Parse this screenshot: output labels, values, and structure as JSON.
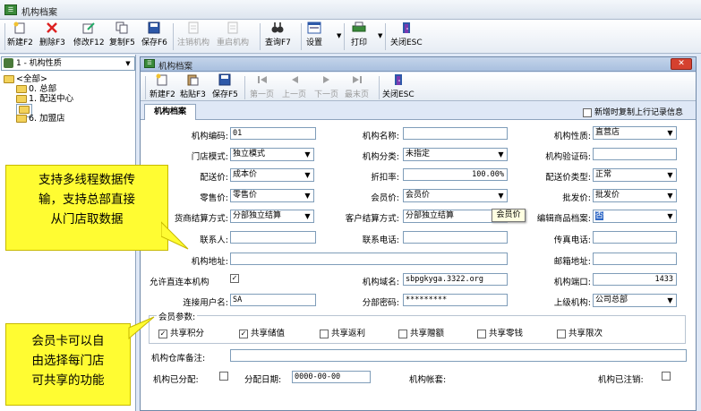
{
  "app": {
    "title": "机构档案"
  },
  "main_toolbar": [
    {
      "id": "new",
      "label": "新建F2",
      "icon": "new-doc-icon",
      "enabled": true
    },
    {
      "id": "delete",
      "label": "删除F3",
      "icon": "delete-x-icon",
      "enabled": true
    },
    {
      "id": "modify",
      "label": "修改F12",
      "icon": "edit-icon",
      "enabled": true
    },
    {
      "id": "copy",
      "label": "复制F5",
      "icon": "copy-icon",
      "enabled": true
    },
    {
      "id": "save",
      "label": "保存F6",
      "icon": "save-disk-icon",
      "enabled": true
    },
    {
      "id": "cancel-org",
      "label": "注销机构",
      "icon": "cancel-doc-icon",
      "enabled": false
    },
    {
      "id": "restart-org",
      "label": "重启机构",
      "icon": "restart-doc-icon",
      "enabled": false
    },
    {
      "id": "query",
      "label": "查询F7",
      "icon": "binoculars-icon",
      "enabled": true
    },
    {
      "id": "settings",
      "label": "设置",
      "icon": "settings-window-icon",
      "enabled": true
    },
    {
      "id": "print",
      "label": "打印",
      "icon": "printer-icon",
      "enabled": true
    },
    {
      "id": "close",
      "label": "关闭ESC",
      "icon": "exit-door-icon",
      "enabled": true
    }
  ],
  "sidebar": {
    "combo_value": "1 - 机构性质",
    "tree": [
      {
        "label": "<全部>",
        "level": 0
      },
      {
        "label": "0. 总部",
        "level": 1
      },
      {
        "label": "1. 配送中心",
        "level": 1
      },
      {
        "label": "5. 直营店",
        "level": 1,
        "selected": true
      },
      {
        "label": "6. 加盟店",
        "level": 1
      }
    ]
  },
  "inner_window": {
    "title": "机构档案",
    "toolbar": [
      {
        "id": "new",
        "label": "新建F2",
        "icon": "new-doc-icon",
        "enabled": true
      },
      {
        "id": "paste",
        "label": "粘贴F3",
        "icon": "paste-icon",
        "enabled": true
      },
      {
        "id": "save",
        "label": "保存F5",
        "icon": "save-disk-icon",
        "enabled": true
      },
      {
        "id": "first",
        "label": "第一页",
        "icon": "first-page-icon",
        "enabled": false
      },
      {
        "id": "prev",
        "label": "上一页",
        "icon": "prev-page-icon",
        "enabled": false
      },
      {
        "id": "next",
        "label": "下一页",
        "icon": "next-page-icon",
        "enabled": false
      },
      {
        "id": "last",
        "label": "最末页",
        "icon": "last-page-icon",
        "enabled": false
      },
      {
        "id": "close",
        "label": "关闭ESC",
        "icon": "exit-door-icon",
        "enabled": true
      }
    ],
    "tab_label": "机构档案",
    "copy_prev_label": "新增时复制上行记录信息"
  },
  "form": {
    "org_code": {
      "label": "机构编码:",
      "value": "01"
    },
    "org_name": {
      "label": "机构名称:",
      "value": ""
    },
    "org_nature": {
      "label": "机构性质:",
      "value": "直营店"
    },
    "store_mode": {
      "label": "门店模式:",
      "value": "独立模式"
    },
    "org_category": {
      "label": "机构分类:",
      "value": "未指定"
    },
    "org_verify_code": {
      "label": "机构验证码:",
      "value": ""
    },
    "delivery_price": {
      "label": "配送价:",
      "value": "成本价"
    },
    "discount_rate": {
      "label": "折扣率:",
      "value": "100.00%"
    },
    "delivery_price_type": {
      "label": "配送价类型:",
      "value": "正常"
    },
    "retail_price": {
      "label": "零售价:",
      "value": "零售价"
    },
    "member_price": {
      "label": "会员价:",
      "value": "会员价"
    },
    "wholesale_price": {
      "label": "批发价:",
      "value": "批发价"
    },
    "supplier_settlement": {
      "label": "货商结算方式:",
      "value": "分部独立结算"
    },
    "customer_settlement": {
      "label": "客户结算方式:",
      "value": "分部独立结算"
    },
    "edit_goods_archive": {
      "label": "编辑商品档案:",
      "value": "否"
    },
    "contact": {
      "label": "联系人:",
      "value": ""
    },
    "contact_phone": {
      "label": "联系电话:",
      "value": ""
    },
    "fax": {
      "label": "传真电话:",
      "value": ""
    },
    "org_address": {
      "label": "机构地址:",
      "value": ""
    },
    "postal_address": {
      "label": "邮箱地址:",
      "value": ""
    },
    "allow_direct": {
      "label": "允许直连本机构",
      "checked": "✓"
    },
    "org_domain": {
      "label": "机构域名:",
      "value": "sbpgkyga.3322.org"
    },
    "org_port": {
      "label": "机构端口:",
      "value": "1433"
    },
    "conn_user": {
      "label": "连接用户名:",
      "value": "SA"
    },
    "branch_password": {
      "label": "分部密码:",
      "value": "*********"
    },
    "parent_org": {
      "label": "上级机构:",
      "value": "公司总部"
    },
    "member_params": {
      "title": "会员参数:",
      "items": [
        {
          "label": "共享积分",
          "checked": "✓"
        },
        {
          "label": "共享储值",
          "checked": "✓"
        },
        {
          "label": "共享返利",
          "checked": ""
        },
        {
          "label": "共享赠额",
          "checked": ""
        },
        {
          "label": "共享零钱",
          "checked": ""
        },
        {
          "label": "共享限次",
          "checked": ""
        }
      ]
    },
    "warehouse_note": {
      "label": "机构仓库备注:",
      "value": ""
    },
    "allocated": {
      "label": "机构已分配:"
    },
    "alloc_date": {
      "label": "分配日期:",
      "value": "0000-00-00"
    },
    "org_account": {
      "label": "机构帐套:",
      "value": ""
    },
    "deregistered": {
      "label": "机构已注销:"
    }
  },
  "tooltip": "会员价",
  "callouts": {
    "top": [
      "支持多线程数据传",
      "输，支持总部直接",
      "从门店取数据"
    ],
    "bottom": [
      "会员卡可以自",
      "由选择每门店",
      "可共享的功能"
    ]
  }
}
